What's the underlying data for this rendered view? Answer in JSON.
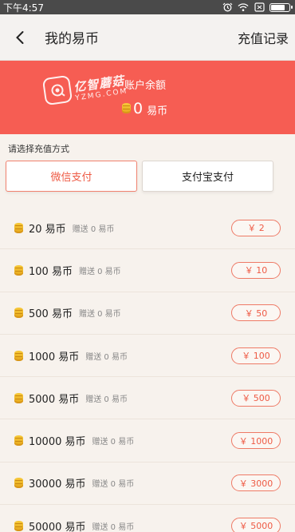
{
  "status_bar": {
    "time": "下午4:57"
  },
  "nav": {
    "title": "我的易币",
    "right_link": "充值记录"
  },
  "banner": {
    "logo_cn": "亿智蘑菇",
    "logo_en": "YZMG.COM",
    "balance_label": "账户余额",
    "balance_amount": "0",
    "balance_unit": "易币"
  },
  "payment": {
    "label": "请选择充值方式",
    "methods": [
      {
        "label": "微信支付",
        "selected": true
      },
      {
        "label": "支付宝支付",
        "selected": false
      }
    ]
  },
  "packages": [
    {
      "amount": "20 易币",
      "bonus": "赠送 0 易币",
      "price": "￥ 2"
    },
    {
      "amount": "100 易币",
      "bonus": "赠送 0 易币",
      "price": "￥ 10"
    },
    {
      "amount": "500 易币",
      "bonus": "赠送 0 易币",
      "price": "￥ 50"
    },
    {
      "amount": "1000 易币",
      "bonus": "赠送 0 易币",
      "price": "￥ 100"
    },
    {
      "amount": "5000 易币",
      "bonus": "赠送 0 易币",
      "price": "￥ 500"
    },
    {
      "amount": "10000 易币",
      "bonus": "赠送 0 易币",
      "price": "￥ 1000"
    },
    {
      "amount": "30000 易币",
      "bonus": "赠送 0 易币",
      "price": "￥ 3000"
    },
    {
      "amount": "50000 易币",
      "bonus": "赠送 0 易币",
      "price": "￥ 5000"
    }
  ],
  "colors": {
    "accent": "#f65d53",
    "price_text": "#ee5a44",
    "coin": "#f2b82a"
  },
  "icons": [
    "back-arrow-icon",
    "alarm-icon",
    "wifi-icon",
    "sim-icon",
    "battery-icon",
    "coin-icon"
  ]
}
